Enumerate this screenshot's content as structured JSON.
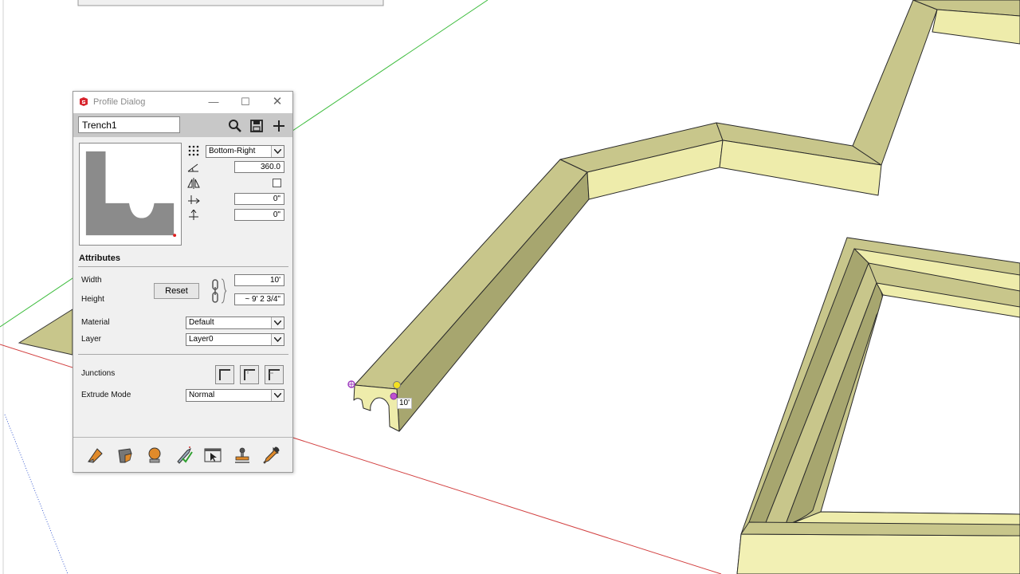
{
  "dialog": {
    "title": "Profile Dialog",
    "profile_name": "Trench1",
    "alignment": "Bottom-Right",
    "rotation": "360.0",
    "offset_x": "0\"",
    "offset_y": "0\""
  },
  "attributes": {
    "heading": "Attributes",
    "width_label": "Width",
    "height_label": "Height",
    "reset_label": "Reset",
    "width_value": "10'",
    "height_value": "~ 9' 2 3/4\"",
    "material_label": "Material",
    "material_value": "Default",
    "layer_label": "Layer",
    "layer_value": "Layer0",
    "junctions_label": "Junctions",
    "extrude_label": "Extrude Mode",
    "extrude_value": "Normal"
  },
  "viewport": {
    "dimension_label": "10'"
  },
  "colors": {
    "face_light": "#eeecab",
    "face_mid": "#c8c68b",
    "face_dark": "#a7a66f",
    "profile_gray": "#8b8b8b",
    "red_axis": "#d24040",
    "green_axis": "#3cbc3c"
  }
}
